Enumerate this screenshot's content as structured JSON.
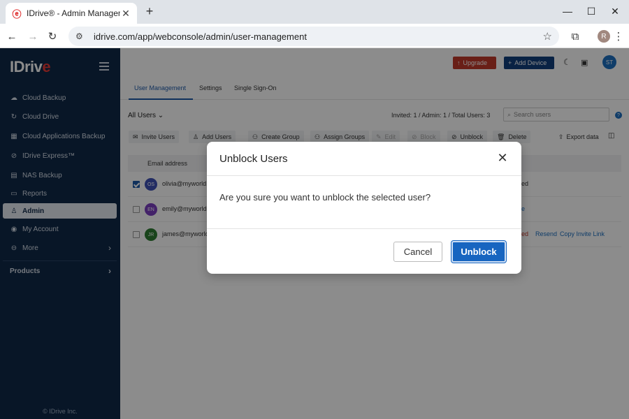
{
  "browser": {
    "tab_title": "IDrive® - Admin Management",
    "url": "idrive.com/app/webconsole/admin/user-management",
    "profile_initial": "R"
  },
  "sidebar": {
    "logo_text": "IDriv",
    "logo_e": "e",
    "items": [
      {
        "label": "Cloud Backup",
        "icon": "cloud-backup-icon"
      },
      {
        "label": "Cloud Drive",
        "icon": "cloud-drive-icon"
      },
      {
        "label": "Cloud Applications Backup",
        "icon": "apps-icon"
      },
      {
        "label": "IDrive Express™",
        "icon": "express-icon"
      },
      {
        "label": "NAS Backup",
        "icon": "nas-icon"
      },
      {
        "label": "Reports",
        "icon": "reports-icon"
      },
      {
        "label": "Admin",
        "icon": "admin-icon",
        "active": true
      },
      {
        "label": "My Account",
        "icon": "account-icon"
      },
      {
        "label": "More",
        "icon": "more-icon"
      }
    ],
    "products_label": "Products",
    "copyright": "© IDrive Inc."
  },
  "header": {
    "upgrade_label": "Upgrade",
    "add_device_label": "Add Device",
    "avatar_initials": "ST"
  },
  "page_tabs": [
    "User Management",
    "Settings",
    "Single Sign-On"
  ],
  "filter": {
    "all_users_label": "All Users",
    "counts": "Invited: 1  / Admin: 1  / Total Users: 3",
    "search_placeholder": "Search users"
  },
  "actions": {
    "invite": "Invite Users",
    "add": "Add Users",
    "create_group": "Create Group",
    "assign_groups": "Assign Groups",
    "edit": "Edit",
    "block": "Block",
    "unblock": "Unblock",
    "delete": "Delete",
    "export": "Export data"
  },
  "table": {
    "header_email": "Email address",
    "rows": [
      {
        "initials": "OS",
        "email": "olivia@myworld.",
        "color": "#3f51b5",
        "checked": true,
        "right": "ed"
      },
      {
        "initials": "EN",
        "email": "emily@myworld",
        "color": "#7b3fbf",
        "checked": false,
        "right": "e"
      },
      {
        "initials": "JR",
        "email": "james@myworld",
        "color": "#2e7d32",
        "checked": false,
        "right": "ed",
        "resend": "Resend",
        "copy_link": "Copy Invite Link"
      }
    ]
  },
  "modal": {
    "title": "Unblock Users",
    "message": "Are you sure you want to unblock the selected user?",
    "cancel_label": "Cancel",
    "confirm_label": "Unblock"
  },
  "colors": {
    "sidebar_bg": "#0f2847",
    "primary": "#1765c0",
    "upgrade": "#c0392b"
  }
}
